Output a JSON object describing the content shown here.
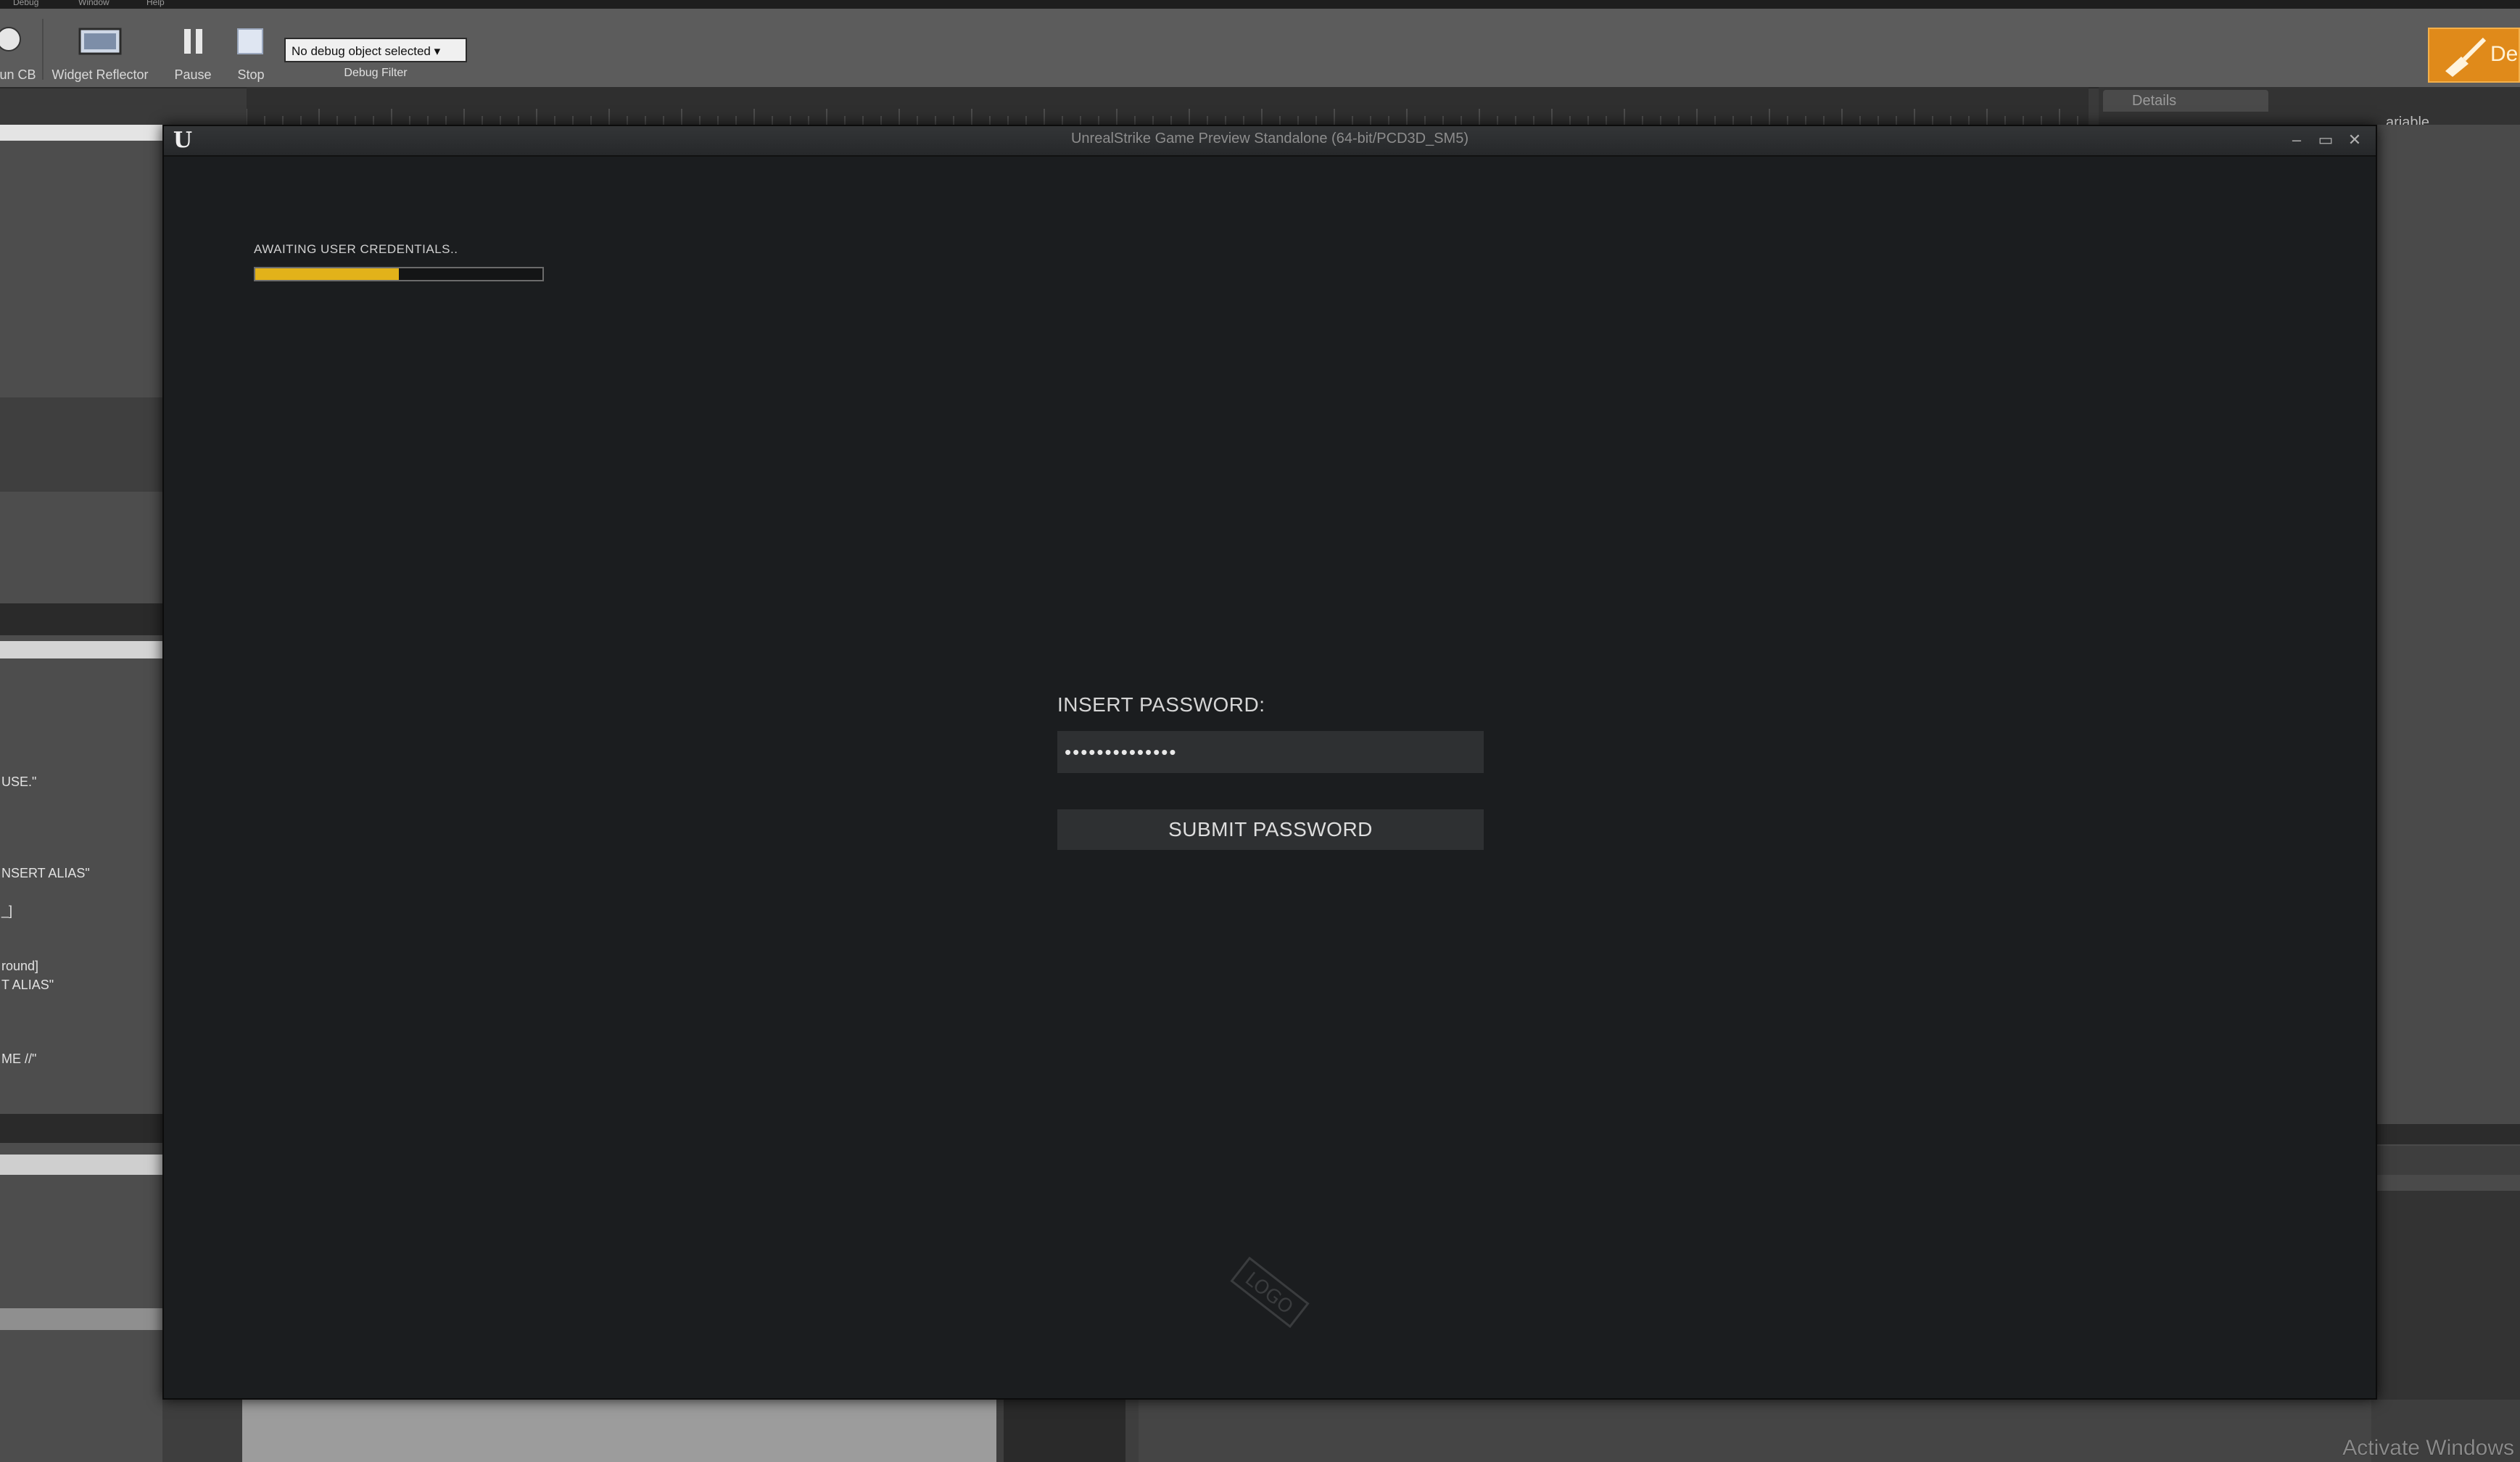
{
  "menubar": {
    "items": [
      "Debug",
      "Window",
      "Help"
    ]
  },
  "toolbar": {
    "items": [
      {
        "label": "Run CB",
        "icon": "run-icon"
      },
      {
        "label": "Widget Reflector",
        "icon": "widget-reflector-icon"
      },
      {
        "label": "Pause",
        "icon": "pause-icon"
      },
      {
        "label": "Stop",
        "icon": "stop-icon"
      }
    ],
    "debug_select_value": "No debug object selected ▾",
    "debug_filter_label": "Debug Filter",
    "orange_tool_label": "De"
  },
  "details": {
    "tab_label": "Details",
    "variable_label": "ariable"
  },
  "left_panel": {
    "fragments": [
      "USE.\"",
      "NSERT ALIAS\"",
      "_]",
      "round]",
      "T ALIAS\"",
      "ME //\""
    ]
  },
  "game_window": {
    "title": "UnrealStrike Game Preview Standalone (64-bit/PCD3D_SM5)",
    "minimize_symbol": "–",
    "maximize_symbol": "▭",
    "close_symbol": "✕",
    "logo_glyph": "U",
    "status_text": "AWAITING USER CREDENTIALS..",
    "progress_fraction": 0.5,
    "password_label": "INSERT PASSWORD:",
    "password_value": "••••••••••••••",
    "submit_label": "SUBMIT PASSWORD",
    "watermark_text": "LOGO"
  },
  "os_watermark": "Activate Windows",
  "colors": {
    "progress": "#e2b21a",
    "accent_orange": "#e08a1a"
  }
}
